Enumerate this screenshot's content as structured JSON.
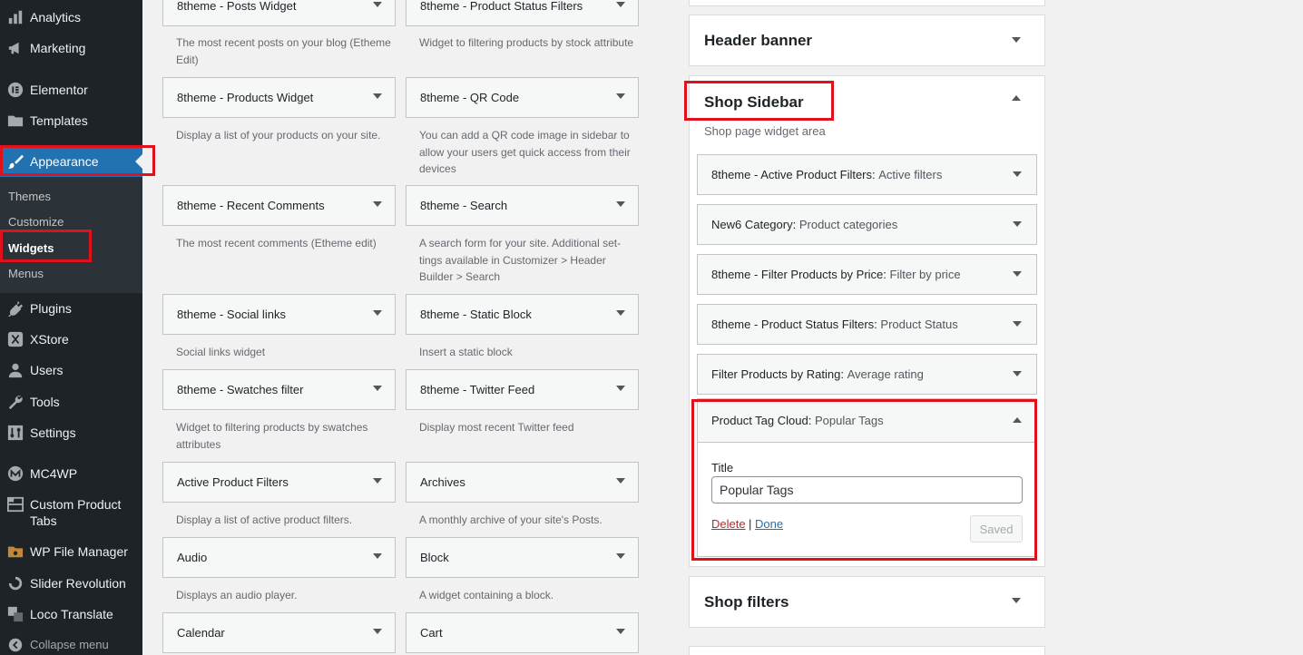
{
  "admin_menu": {
    "items": [
      {
        "label": "Analytics",
        "icon": "bar-chart-icon"
      },
      {
        "label": "Marketing",
        "icon": "megaphone-icon"
      },
      {
        "label": "Elementor",
        "icon": "elementor-icon"
      },
      {
        "label": "Templates",
        "icon": "folder-icon"
      },
      {
        "label": "Appearance",
        "icon": "paintbrush-icon"
      },
      {
        "label": "Plugins",
        "icon": "plug-icon"
      },
      {
        "label": "XStore",
        "icon": "xstore-icon"
      },
      {
        "label": "Users",
        "icon": "user-icon"
      },
      {
        "label": "Tools",
        "icon": "wrench-icon"
      },
      {
        "label": "Settings",
        "icon": "settings-icon"
      },
      {
        "label": "MC4WP",
        "icon": "mc4wp-icon"
      },
      {
        "label": "Custom Product Tabs",
        "icon": "tabs-icon"
      },
      {
        "label": "WP File Manager",
        "icon": "file-manager-icon"
      },
      {
        "label": "Slider Revolution",
        "icon": "slider-revolution-icon"
      },
      {
        "label": "Loco Translate",
        "icon": "translate-icon"
      }
    ],
    "submenu": [
      "Themes",
      "Customize",
      "Widgets",
      "Menus"
    ],
    "collapse_label": "Collapse menu"
  },
  "available_widgets": [
    {
      "name": "8theme - Posts Widget",
      "desc": "The most recent posts on your blog (Etheme Edit)"
    },
    {
      "name": "8theme - Product Status Filters",
      "desc": "Widget to filtering products by stock attribute"
    },
    {
      "name": "8theme - Products Widget",
      "desc": "Display a list of your products on your site."
    },
    {
      "name": "8theme - QR Code",
      "desc": "You can add a QR code image in sidebar to allow your users get quick access from their devices"
    },
    {
      "name": "8theme - Recent Comments",
      "desc": "The most recent comments (Etheme edit)"
    },
    {
      "name": "8theme - Search",
      "desc": "A search form for your site. Additional set-tings available in Customizer > Header Builder > Search"
    },
    {
      "name": "8theme - Social links",
      "desc": "Social links widget"
    },
    {
      "name": "8theme - Static Block",
      "desc": "Insert a static block"
    },
    {
      "name": "8theme - Swatches filter",
      "desc": "Widget to filtering products by swatches attributes"
    },
    {
      "name": "8theme - Twitter Feed",
      "desc": "Display most recent Twitter feed"
    },
    {
      "name": "Active Product Filters",
      "desc": "Display a list of active product filters."
    },
    {
      "name": "Archives",
      "desc": "A monthly archive of your site's Posts."
    },
    {
      "name": "Audio",
      "desc": "Displays an audio player."
    },
    {
      "name": "Block",
      "desc": "A widget containing a block."
    },
    {
      "name": "Calendar",
      "desc": ""
    },
    {
      "name": "Cart",
      "desc": ""
    }
  ],
  "sidebars": {
    "header_banner": {
      "title": "Header banner"
    },
    "shop_sidebar": {
      "title": "Shop Sidebar",
      "description": "Shop page widget area",
      "widgets": [
        {
          "name": "8theme - Active Product Filters:",
          "title": "Active filters"
        },
        {
          "name": "New6 Category:",
          "title": "Product categories"
        },
        {
          "name": "8theme - Filter Products by Price:",
          "title": "Filter by price"
        },
        {
          "name": "8theme - Product Status Filters:",
          "title": "Product Status"
        },
        {
          "name": "Filter Products by Rating:",
          "title": "Average rating"
        }
      ],
      "expanded_widget": {
        "name": "Product Tag Cloud:",
        "title": "Popular Tags",
        "field_label": "Title",
        "field_value": "Popular Tags",
        "delete_label": "Delete",
        "separator": "|",
        "done_label": "Done",
        "saved_label": "Saved"
      }
    },
    "shop_filters": {
      "title": "Shop filters"
    }
  },
  "colors": {
    "menu_bg": "#1d2327",
    "menu_current": "#2271b1",
    "highlight": "#e0111b",
    "link": "#2271b1",
    "delete": "#b32d2e"
  }
}
